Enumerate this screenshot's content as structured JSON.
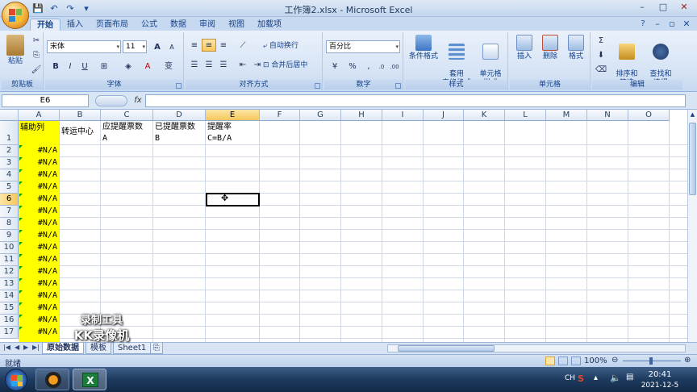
{
  "window": {
    "title": "工作簿2.xlsx - Microsoft Excel",
    "controls": [
      "–",
      "□",
      "✕"
    ]
  },
  "ribbon_tabs": [
    "开始",
    "插入",
    "页面布局",
    "公式",
    "数据",
    "审阅",
    "视图",
    "加载项"
  ],
  "ribbon": {
    "clipboard": {
      "paste_label": "粘贴",
      "group_label": "剪贴板"
    },
    "font": {
      "name": "宋体",
      "size": "11",
      "bold": "B",
      "italic": "I",
      "underline": "U",
      "grow": "A",
      "shrink": "A",
      "wen": "变",
      "group_label": "字体",
      "highlight_color": "#ffff00",
      "font_color": "#ff0000"
    },
    "alignment": {
      "wrap_label": "自动换行",
      "merge_label": "合并后居中",
      "group_label": "对齐方式"
    },
    "number": {
      "format": "百分比",
      "percent": "%",
      "comma": ",",
      "group_label": "数字"
    },
    "styles": {
      "conditional_label": "条件格式",
      "table_label": "套用\n表格格式",
      "cell_style_label": "单元格\n样式",
      "group_label": "样式"
    },
    "cells": {
      "insert_label": "插入",
      "delete_label": "删除",
      "format_label": "格式",
      "group_label": "单元格"
    },
    "editing": {
      "sort_label": "排序和\n筛选",
      "find_label": "查找和\n选择",
      "group_label": "编辑"
    }
  },
  "formula_bar": {
    "name_box": "E6",
    "fx": "fx",
    "content": ""
  },
  "sheet": {
    "columns": [
      "A",
      "B",
      "C",
      "D",
      "E",
      "F",
      "G",
      "H",
      "I",
      "J",
      "K",
      "L",
      "M",
      "N",
      "O"
    ],
    "active_column": "E",
    "active_row": "6",
    "rows": [
      "1",
      "2",
      "3",
      "4",
      "5",
      "6",
      "7",
      "8",
      "9",
      "10",
      "11",
      "12",
      "13",
      "14",
      "15",
      "16",
      "17"
    ],
    "header_row": {
      "A": "辅助列",
      "B": "转运中心",
      "C1": "应提醒票数",
      "C2": "A",
      "D1": "已提醒票数",
      "D2": "B",
      "E1": "提醒率",
      "E2": "C=B/A"
    },
    "a_values": [
      "#N/A",
      "#N/A",
      "#N/A",
      "#N/A",
      "#N/A",
      "#N/A",
      "#N/A",
      "#N/A",
      "#N/A",
      "#N/A",
      "#N/A",
      "#N/A",
      "#N/A",
      "#N/A",
      "#N/A",
      "#N/A"
    ],
    "helper_column_color": "#ffff00"
  },
  "sheet_tabs": [
    "原始数据",
    "模板",
    "Sheet1"
  ],
  "active_sheet": "原始数据",
  "status": {
    "text": "就绪",
    "zoom": "100%"
  },
  "watermark": {
    "line1": "录制工具",
    "line2": "KK录像机"
  },
  "taskbar": {
    "lang": "CH",
    "time": "20:41",
    "date": "2021-12-5"
  }
}
